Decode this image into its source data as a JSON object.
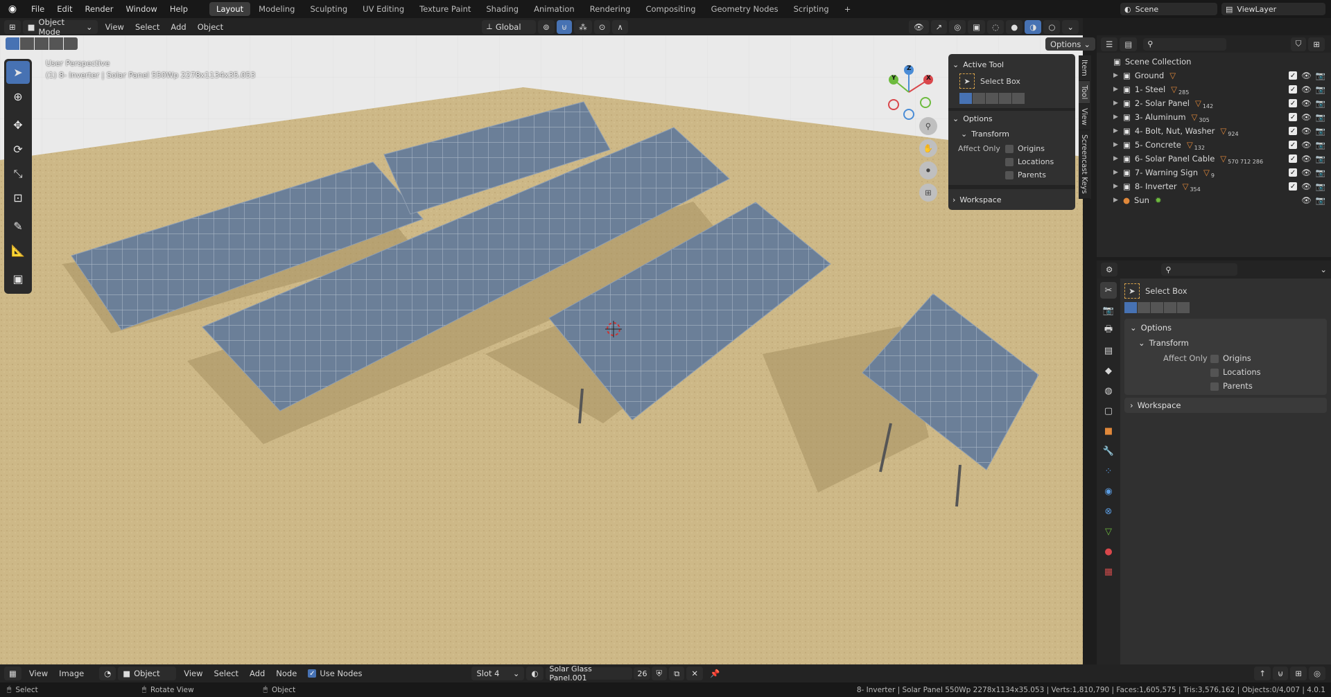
{
  "menubar": {
    "items": [
      "File",
      "Edit",
      "Render",
      "Window",
      "Help"
    ],
    "workspaces": [
      "Layout",
      "Modeling",
      "Sculpting",
      "UV Editing",
      "Texture Paint",
      "Shading",
      "Animation",
      "Rendering",
      "Compositing",
      "Geometry Nodes",
      "Scripting"
    ],
    "active_workspace": "Layout",
    "add_tab": "+",
    "scene": "Scene",
    "view_layer": "ViewLayer"
  },
  "viewport_header": {
    "mode": "Object Mode",
    "menus": [
      "View",
      "Select",
      "Add",
      "Object"
    ],
    "orientation": "Global",
    "options": "Options"
  },
  "viewport": {
    "perspective": "User Perspective",
    "object_info": "(1) 8- Inverter | Solar Panel 550Wp 2278x1134x35.053",
    "gizmo_axes": [
      "X",
      "Y",
      "Z"
    ]
  },
  "tool_panel": {
    "active_tool_header": "Active Tool",
    "tool_name": "Select Box",
    "options_header": "Options",
    "transform_header": "Transform",
    "affect_only": "Affect Only",
    "checks": [
      "Origins",
      "Locations",
      "Parents"
    ],
    "workspace_header": "Workspace"
  },
  "npanel_tabs": [
    "Item",
    "Tool",
    "View",
    "Screencast Keys"
  ],
  "outliner": {
    "root": "Scene Collection",
    "items": [
      {
        "name": "Ground",
        "count": ""
      },
      {
        "name": "1- Steel",
        "count": "285"
      },
      {
        "name": "2- Solar Panel",
        "count": "142"
      },
      {
        "name": "3- Aluminum",
        "count": "305"
      },
      {
        "name": "4- Bolt, Nut, Washer",
        "count": "924"
      },
      {
        "name": "5- Concrete",
        "count": "132"
      },
      {
        "name": "6- Solar Panel Cable",
        "count": "570 712 286"
      },
      {
        "name": "7- Warning Sign",
        "count": "9"
      },
      {
        "name": "8- Inverter",
        "count": "354"
      },
      {
        "name": "Sun",
        "count": ""
      }
    ]
  },
  "properties": {
    "tool_name": "Select Box",
    "options_header": "Options",
    "transform_header": "Transform",
    "affect_only": "Affect Only",
    "checks": [
      "Origins",
      "Locations",
      "Parents"
    ],
    "workspace_header": "Workspace"
  },
  "editor_bar": {
    "menus": [
      "View",
      "Image"
    ],
    "object": "Object",
    "menus2": [
      "View",
      "Select",
      "Add",
      "Node"
    ],
    "use_nodes": "Use Nodes",
    "slot": "Slot 4",
    "material": "Solar Glass Panel.001",
    "users": "26"
  },
  "statusbar": {
    "select": "Select",
    "rotate": "Rotate View",
    "object": "Object",
    "stats": "8- Inverter | Solar Panel 550Wp 2278x1134x35.053 | Verts:1,810,790 | Faces:1,605,575 | Tris:3,576,162 | Objects:0/4,007 | 4.0.1"
  },
  "colors": {
    "accent": "#4772b3",
    "ground": "#cdb887",
    "panel": "#6a7f98"
  }
}
